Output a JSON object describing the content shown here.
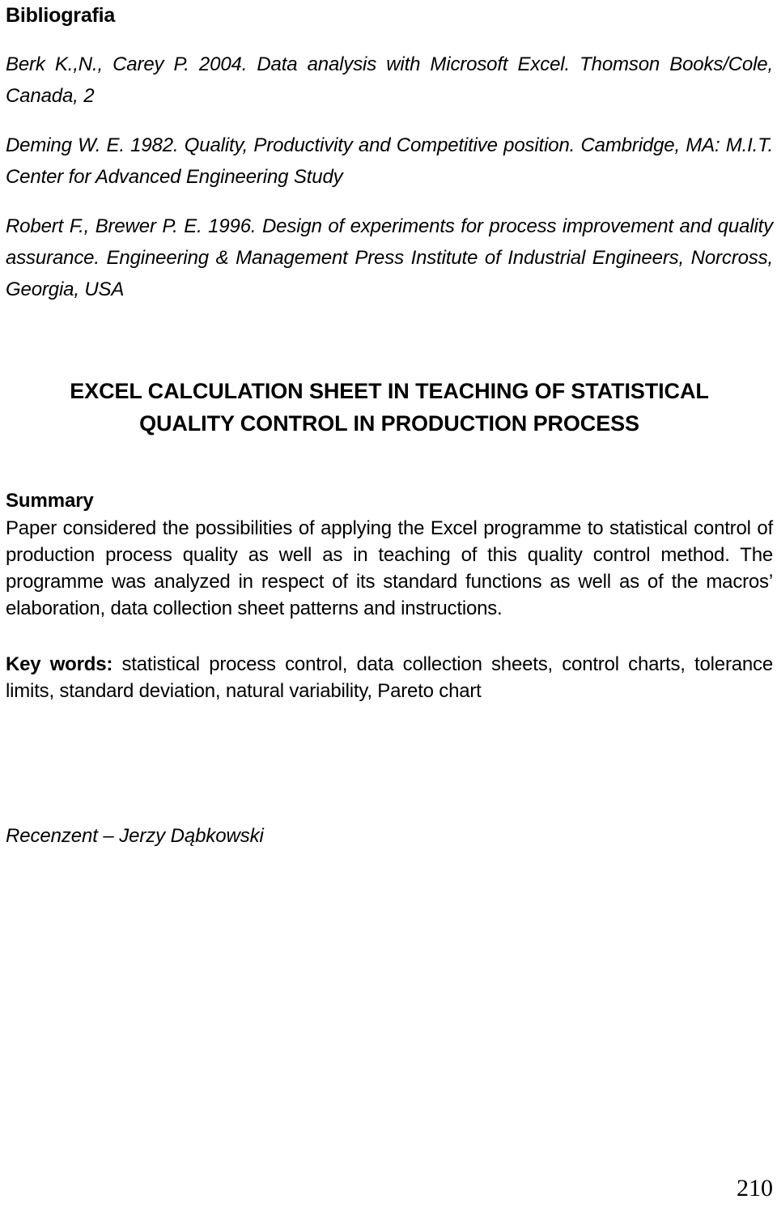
{
  "document": {
    "page_number": "210"
  },
  "bibliography": {
    "heading": "Bibliografia",
    "entries": [
      "Berk K.,N., Carey P. 2004. Data analysis with Microsoft Excel. Thomson Books/Cole, Canada, 2",
      "Deming W. E. 1982. Quality, Productivity and Competitive position. Cambridge, MA: M.I.T. Center for Advanced Engineering Study",
      "Robert F., Brewer P. E. 1996. Design of experiments for process improvement and quality assurance. Engineering & Management Press Institute of Industrial Engineers, Norcross, Georgia, USA"
    ]
  },
  "article": {
    "title_line_1": "EXCEL CALCULATION SHEET IN TEACHING OF STATISTICAL",
    "title_line_2": "QUALITY CONTROL IN PRODUCTION PROCESS"
  },
  "summary": {
    "heading": "Summary",
    "body": "Paper considered the possibilities of applying the Excel programme to statistical control of production process quality as well as in teaching of this quality control method. The programme was analyzed in respect of its standard functions as well as of the macros’ elaboration, data collection sheet patterns and instructions."
  },
  "keywords": {
    "label": "Key words:",
    "terms": " statistical process control, data collection sheets, control charts, tolerance limits, standard deviation, natural variability, Pareto chart"
  },
  "reviewer": {
    "text": "Recenzent – Jerzy Dąbkowski"
  }
}
